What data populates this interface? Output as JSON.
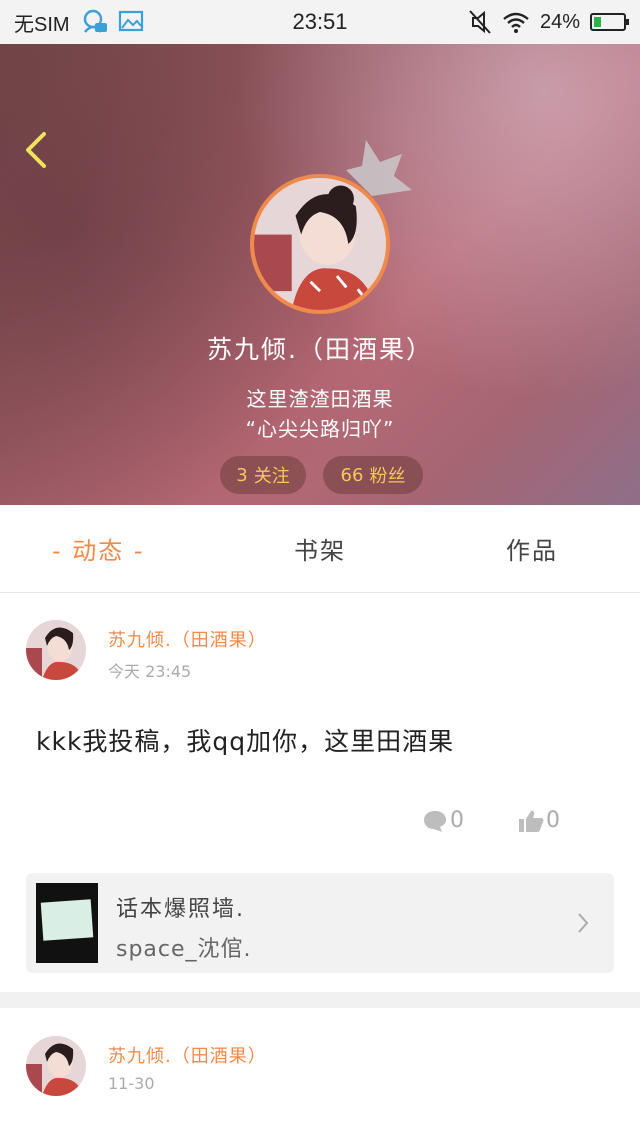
{
  "status_bar": {
    "carrier": "无SIM",
    "time": "23:51",
    "battery": "24%",
    "battery_level": 0.24
  },
  "profile": {
    "username": "苏九倾.（田酒果）",
    "bio_line1": "这里渣渣田酒果",
    "bio_line2": "“心尖尖路归吖”",
    "following_count": "3",
    "following_label": "关注",
    "fans_count": "66",
    "fans_label": "粉丝"
  },
  "tabs": [
    {
      "label": "- 动态 -",
      "active": true
    },
    {
      "label": "书架",
      "active": false
    },
    {
      "label": "作品",
      "active": false
    }
  ],
  "posts": [
    {
      "author": "苏九倾.（田酒果）",
      "time": "今天 23:45",
      "text": "kkk我投稿，我qq加你，这里田酒果",
      "comments": "0",
      "likes": "0",
      "share": {
        "title": "话本爆照墙.",
        "subtitle": "space_沈倌."
      }
    },
    {
      "author": "苏九倾.（田酒果）",
      "time": "11-30"
    }
  ],
  "colors": {
    "accent": "#f08a4b",
    "pill_text": "#f7c75a",
    "back_arrow": "#f2e35a"
  },
  "icons": [
    "notification-chat-icon",
    "image-icon",
    "silent-icon",
    "wifi-icon",
    "battery-icon",
    "back-arrow-icon",
    "crown-icon",
    "comment-icon",
    "thumbs-up-icon",
    "chevron-right-icon"
  ]
}
